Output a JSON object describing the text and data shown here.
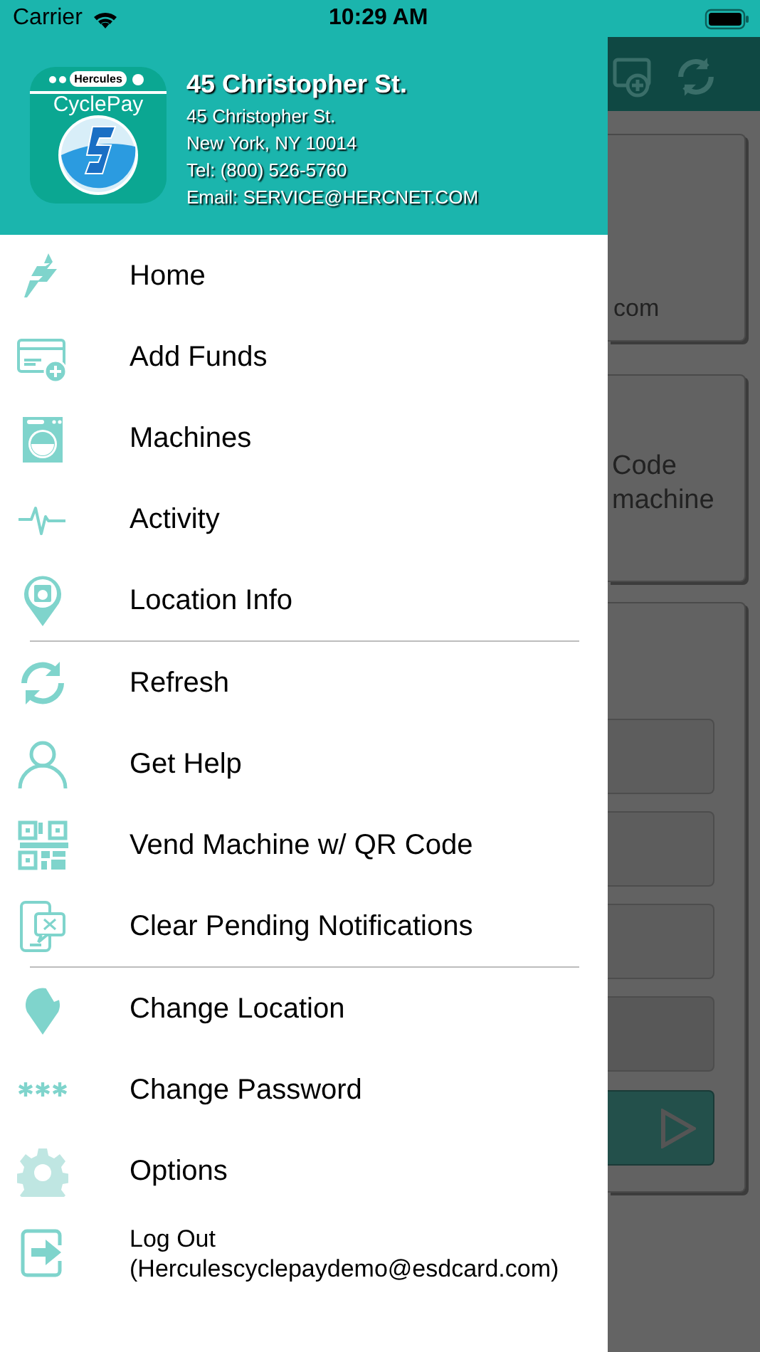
{
  "status_bar": {
    "carrier": "Carrier",
    "time": "10:29 AM"
  },
  "header": {
    "title": "45 Christopher St.",
    "lines": [
      "45 Christopher St.",
      "New York, NY 10014",
      "Tel: (800) 526-5760",
      "Email: SERVICE@HERCNET.COM"
    ],
    "logo": {
      "brand": "Hercules",
      "name": "CyclePay"
    }
  },
  "menu": [
    {
      "items": [
        {
          "kind": "home",
          "label": "Home"
        },
        {
          "kind": "funds",
          "label": "Add Funds"
        },
        {
          "kind": "machine",
          "label": "Machines"
        },
        {
          "kind": "activity",
          "label": "Activity"
        },
        {
          "kind": "pin",
          "label": "Location Info"
        }
      ]
    },
    {
      "items": [
        {
          "kind": "refresh",
          "label": "Refresh"
        },
        {
          "kind": "person",
          "label": "Get Help"
        },
        {
          "kind": "qr",
          "label": "Vend Machine w/ QR Code"
        },
        {
          "kind": "phone",
          "label": "Clear Pending Notifications"
        }
      ]
    },
    {
      "items": [
        {
          "kind": "pin2",
          "label": "Change Location"
        },
        {
          "kind": "password",
          "label": "Change Password"
        },
        {
          "kind": "gear",
          "label": "Options"
        },
        {
          "kind": "logout",
          "label": "Log Out",
          "sub": "(Herculescyclepaydemo@esdcard.com)"
        }
      ]
    }
  ],
  "background_screen": {
    "card_1_text": "com",
    "card_2_lines": [
      "Code",
      "machine"
    ]
  }
}
